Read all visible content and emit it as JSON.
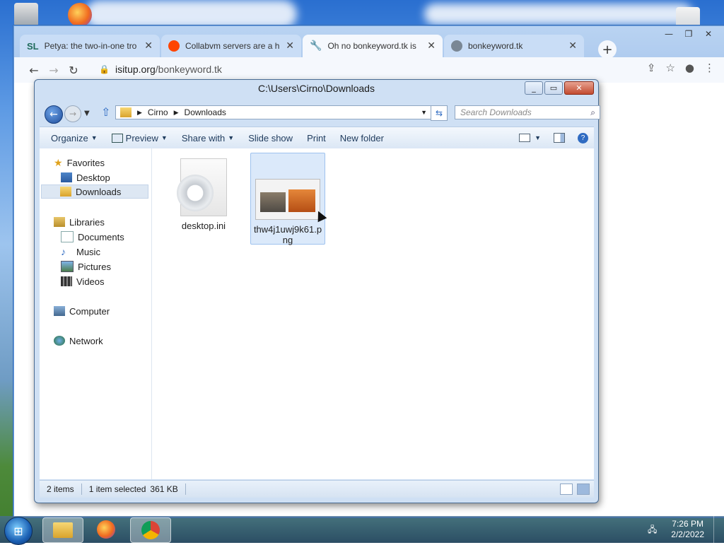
{
  "browser": {
    "tabs": [
      {
        "favicon_text": "SL",
        "title": "Petya: the two-in-one tro"
      },
      {
        "favicon_text": "",
        "title": "Collabvm servers are a hu"
      },
      {
        "favicon_text": "",
        "title": "Oh no bonkeyword.tk is"
      },
      {
        "favicon_text": "",
        "title": "bonkeyword.tk"
      }
    ],
    "active_tab_index": 2,
    "new_tab_symbol": "+",
    "url_domain": "isitup.org",
    "url_path": "/bonkeyword.tk"
  },
  "explorer": {
    "title": "C:\\Users\\Cirno\\Downloads",
    "breadcrumb": [
      "Cirno",
      "Downloads"
    ],
    "search_placeholder": "Search Downloads",
    "commands": [
      "Organize",
      "Preview",
      "Share with",
      "Slide show",
      "Print",
      "New folder"
    ],
    "nav": {
      "favorites": "Favorites",
      "desktop": "Desktop",
      "downloads": "Downloads",
      "libraries": "Libraries",
      "documents": "Documents",
      "music": "Music",
      "pictures": "Pictures",
      "videos": "Videos",
      "computer": "Computer",
      "network": "Network"
    },
    "files": [
      {
        "name": "desktop.ini",
        "selected": false
      },
      {
        "name": "thw4j1uwj9k61.png",
        "name_line1": "thw4j1uwj9k61.p",
        "name_line2": "ng",
        "selected": true
      }
    ],
    "status": {
      "items": "2 items",
      "selected": "1 item selected",
      "size": "361 KB"
    }
  },
  "taskbar": {
    "time": "7:26 PM",
    "date": "2/2/2022"
  },
  "colors": {
    "selection": "#dbe9fa",
    "accent": "#2f6bc2"
  }
}
